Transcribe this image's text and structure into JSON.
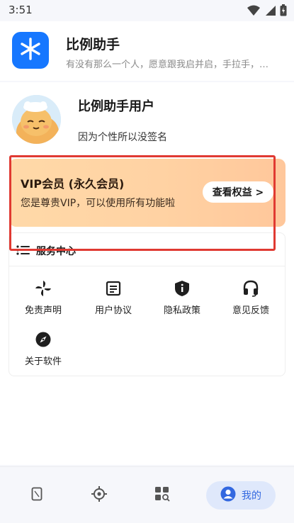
{
  "status_bar": {
    "time": "3:51",
    "icons": [
      "wifi-icon",
      "signal-icon",
      "battery-icon"
    ]
  },
  "app": {
    "title": "比例助手",
    "subtitle": "有没有那么一个人，愿意跟我启并启，手拉手，…",
    "logo_icon": "asterisk-logo-icon",
    "brand_color": "#1677ff"
  },
  "profile": {
    "name": "比例助手用户",
    "signature": "因为个性所以没签名",
    "avatar_icon": "cartoon-cat-avatar"
  },
  "vip": {
    "title": "VIP会员 (永久会员)",
    "description": "您是尊贵VIP，可以使用所有功能啦",
    "button_label": "查看权益 >",
    "gradient_start": "#ffd9a8",
    "gradient_end": "#ffc79b",
    "highlight_color": "#e03a32"
  },
  "service_center": {
    "title": "服务中心",
    "items": [
      {
        "label": "免责声明",
        "icon": "pinwheel-icon"
      },
      {
        "label": "用户协议",
        "icon": "document-icon"
      },
      {
        "label": "隐私政策",
        "icon": "shield-info-icon"
      },
      {
        "label": "意见反馈",
        "icon": "headset-icon"
      },
      {
        "label": "关于软件",
        "icon": "compass-icon"
      }
    ]
  },
  "bottom_nav": {
    "items": [
      {
        "icon": "phone-icon",
        "label": ""
      },
      {
        "icon": "target-icon",
        "label": ""
      },
      {
        "icon": "apps-search-icon",
        "label": ""
      },
      {
        "icon": "user-icon",
        "label": "我的",
        "active": true
      }
    ],
    "active_color": "#3368e0"
  }
}
